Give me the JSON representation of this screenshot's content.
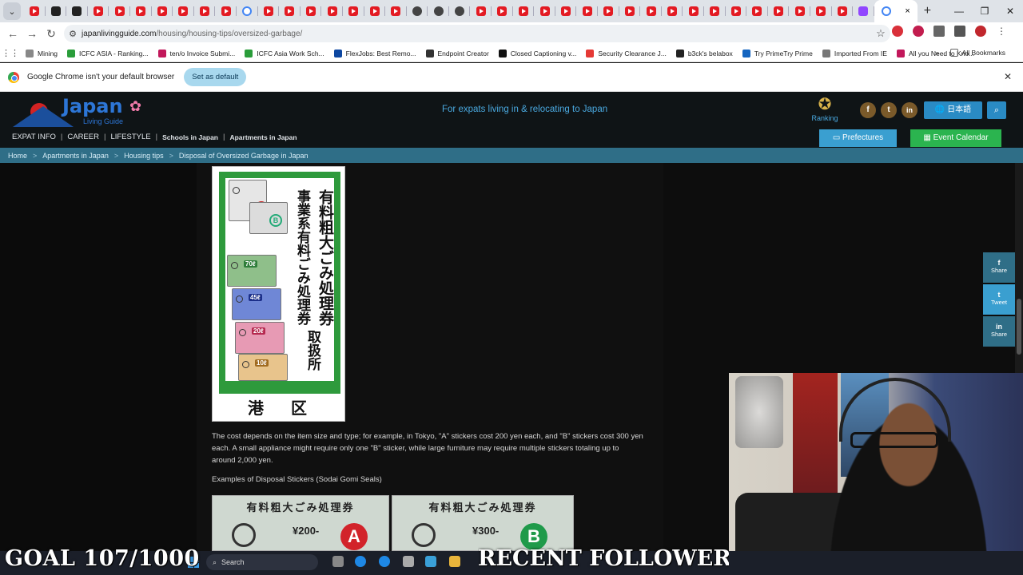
{
  "browser": {
    "tab_count_icons": [
      "yt",
      "dark",
      "dark",
      "yt",
      "yt",
      "yt",
      "yt",
      "yt",
      "yt",
      "yt",
      "g",
      "yt",
      "yt",
      "yt",
      "yt",
      "yt",
      "yt",
      "yt",
      "gh",
      "gh",
      "gh",
      "yt",
      "yt",
      "yt",
      "yt",
      "yt",
      "yt",
      "yt",
      "yt",
      "yt",
      "yt",
      "yt",
      "yt",
      "yt",
      "yt",
      "yt",
      "yt",
      "yt",
      "yt",
      "tw",
      "g"
    ],
    "active_tab_close": "×",
    "new_tab": "+",
    "window_controls": [
      "—",
      "❐",
      "✕"
    ],
    "url_host": "japanlivingguide.com",
    "url_path": "/housing/housing-tips/oversized-garbage/",
    "bookmarks": [
      "Mining",
      "ICFC ASIA - Ranking...",
      "ten/o Invoice Submi...",
      "ICFC Asia Work Sch...",
      "FlexJobs: Best Remo...",
      "Endpoint Creator",
      "Closed Captioning v...",
      "Security Clearance J...",
      "b3ck's belabox",
      "Try PrimeTry Prime",
      "Imported From IE",
      "All you Need to Kno..."
    ],
    "all_bookmarks": "All Bookmarks",
    "bookmarks_more": "»"
  },
  "infobar": {
    "message": "Google Chrome isn't your default browser",
    "button": "Set as default",
    "close": "✕"
  },
  "site": {
    "logo_word": "Japan",
    "logo_sub": "Living Guide",
    "tagline": "For expats living in & relocating to Japan",
    "ranking": "Ranking",
    "social": [
      "f",
      "t",
      "in"
    ],
    "lang_button": "🌐 日本語",
    "nav": [
      "EXPAT INFO",
      "CAREER",
      "LIFESTYLE",
      "Schools in Japan",
      "Apartments in Japan"
    ],
    "prefectures": "Prefectures",
    "event_calendar": "Event Calendar",
    "breadcrumb": [
      "Home",
      "Apartments in Japan",
      "Housing tips",
      "Disposal of Oversized Garbage in Japan"
    ]
  },
  "article": {
    "sign_vertical_1": "有料粗大ごみ処理券",
    "sign_vertical_2": "事業系有料ごみ処理券",
    "sign_vertical_3": "取扱所",
    "sign_ward": "港区",
    "sign_stickers": [
      "A",
      "B",
      "70ℓ",
      "45ℓ",
      "20ℓ",
      "10ℓ"
    ],
    "paragraph": "The cost depends on the item size and type; for example, in Tokyo, \"A\" stickers cost 200 yen each, and \"B\" stickers cost 300 yen each. A small appliance might require only one \"B\" sticker, while large furniture may require multiple stickers totaling up to around 2,000 yen.",
    "examples_title": "Examples of Disposal Stickers (Sodai Gomi Seals)",
    "example_header": "有料粗大ごみ処理券",
    "example_a_price": "¥200-",
    "example_b_price": "¥300-",
    "example_a_letter": "A",
    "example_b_letter": "B"
  },
  "share": [
    {
      "icon": "f",
      "label": "Share",
      "color": "#2f6e87"
    },
    {
      "icon": "t",
      "label": "Tweet",
      "color": "#3a9fd0"
    },
    {
      "icon": "in",
      "label": "Share",
      "color": "#2f6e87"
    }
  ],
  "overlay": {
    "goal": "GOAL 107/1000",
    "recent": "RECENT FOLLOWER: I"
  },
  "taskbar": {
    "search": "Search"
  }
}
